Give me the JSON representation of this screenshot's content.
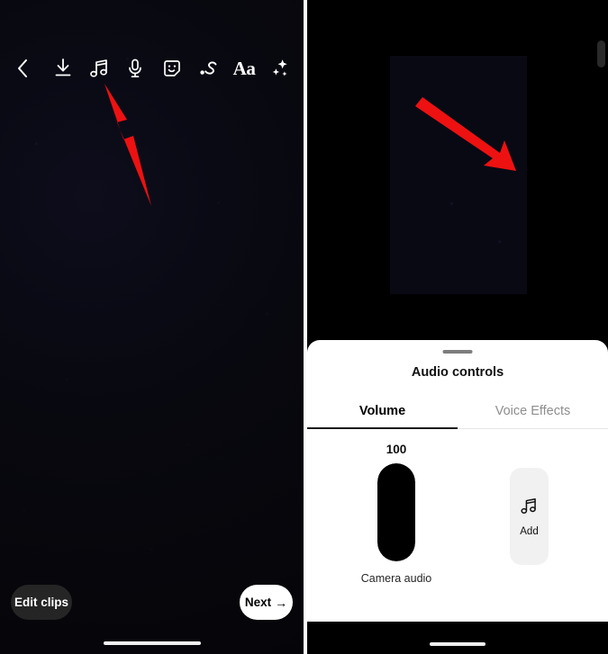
{
  "left_screen": {
    "name": "Reel editor screen",
    "toolbar": {
      "items": [
        {
          "icon": "back-chevron-icon",
          "label": "Back"
        },
        {
          "icon": "download-icon",
          "label": "Save"
        },
        {
          "icon": "music-note-icon",
          "label": "Music"
        },
        {
          "icon": "microphone-icon",
          "label": "Voiceover"
        },
        {
          "icon": "sticker-smiley-icon",
          "label": "Stickers"
        },
        {
          "icon": "draw-squiggle-icon",
          "label": "Draw"
        },
        {
          "icon": "text-aa-icon",
          "label": "Aa"
        },
        {
          "icon": "sparkles-icon",
          "label": "Effects"
        }
      ],
      "aa_text": "Aa"
    },
    "edit_clips_label": "Edit clips",
    "next_label": "Next",
    "next_arrow": "→"
  },
  "right_screen": {
    "name": "Audio controls sheet",
    "sheet": {
      "title": "Audio controls",
      "tabs": [
        {
          "label": "Volume",
          "active": true
        },
        {
          "label": "Voice Effects",
          "active": false
        }
      ],
      "volume": {
        "value": "100",
        "value_number": 100,
        "max": 100,
        "track_label": "Camera audio"
      },
      "add_button": {
        "label": "Add",
        "icon": "music-note-icon"
      }
    }
  },
  "annotations": {
    "arrow_color": "#ee1111",
    "arrows": [
      {
        "name": "arrow-to-music-icon",
        "points_to": "music-note-icon"
      },
      {
        "name": "arrow-to-add-button",
        "points_to": "add-button"
      }
    ]
  },
  "colors": {
    "left_bg": "#07070f",
    "sheet_bg": "#ffffff",
    "accent_dark": "#000000",
    "tab_inactive": "#8e8e8e",
    "add_button_bg": "#f1f1f1",
    "slider_fill": "#000000"
  }
}
